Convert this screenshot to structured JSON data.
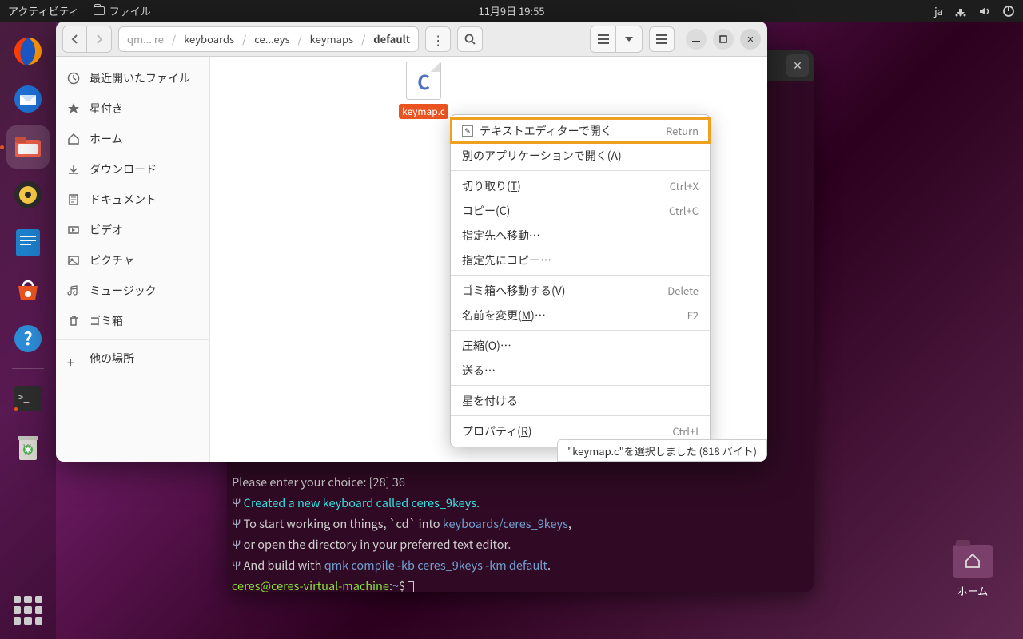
{
  "topbar": {
    "activities": "アクティビティ",
    "app_name": "ファイル",
    "datetime": "11月9日  19:55",
    "lang": "ja"
  },
  "dock": {
    "items": [
      {
        "name": "firefox"
      },
      {
        "name": "thunderbird"
      },
      {
        "name": "files",
        "active": true
      },
      {
        "name": "rhythmbox"
      },
      {
        "name": "libreoffice-writer"
      },
      {
        "name": "software"
      },
      {
        "name": "help"
      }
    ],
    "terminal": {
      "name": "terminal"
    },
    "trash": {
      "name": "trash"
    }
  },
  "desktop": {
    "home_label": "ホーム"
  },
  "terminal": {
    "lines": {
      "choice": "Please enter your choice:  [28] 36",
      "created": "Created a new keyboard called ceres_9keys.",
      "start": "To start working on things, `cd` into ",
      "start_path": "keyboards/ceres_9keys",
      "start_comma": ",",
      "open_dir": "or open the directory in your preferred text editor.",
      "build": "And build with ",
      "build_cmd": "qmk compile -kb ceres_9keys -km default",
      "build_dot": ".",
      "prompt_user": "ceres@ceres-virtual-machine",
      "prompt_sep": ":",
      "prompt_path": "~",
      "prompt_dollar": "$"
    }
  },
  "files": {
    "breadcrumb": [
      "qm... re",
      "keyboards",
      "ce...eys",
      "keymaps",
      "default"
    ],
    "sidebar": [
      {
        "icon": "recent",
        "label": "最近開いたファイル"
      },
      {
        "icon": "star",
        "label": "星付き"
      },
      {
        "icon": "home",
        "label": "ホーム"
      },
      {
        "icon": "download",
        "label": "ダウンロード"
      },
      {
        "icon": "document",
        "label": "ドキュメント"
      },
      {
        "icon": "video",
        "label": "ビデオ"
      },
      {
        "icon": "picture",
        "label": "ピクチャ"
      },
      {
        "icon": "music",
        "label": "ミュージック"
      },
      {
        "icon": "trash",
        "label": "ゴミ箱"
      }
    ],
    "other_places": "他の場所",
    "file": {
      "name": "keymap.c",
      "letter": "C"
    },
    "status": "\"keymap.c\"を選択しました (818 バイト)"
  },
  "context_menu": [
    {
      "label": "テキストエディターで開く",
      "shortcut": "Return",
      "icon": true,
      "highlighted": true
    },
    {
      "label_pre": "別のアプリケーションで開く(",
      "ul": "A",
      "label_post": ")"
    },
    {
      "sep": true
    },
    {
      "label_pre": "切り取り(",
      "ul": "T",
      "label_post": ")",
      "shortcut": "Ctrl+X"
    },
    {
      "label_pre": "コピー(",
      "ul": "C",
      "label_post": ")",
      "shortcut": "Ctrl+C"
    },
    {
      "label": "指定先へ移動…"
    },
    {
      "label": "指定先にコピー…"
    },
    {
      "sep": true
    },
    {
      "label_pre": "ゴミ箱へ移動する(",
      "ul": "V",
      "label_post": ")",
      "shortcut": "Delete"
    },
    {
      "label_pre": "名前を変更(",
      "ul": "M",
      "label_post": ")…",
      "shortcut": "F2"
    },
    {
      "sep": true
    },
    {
      "label_pre": "圧縮(",
      "ul": "O",
      "label_post": ")…"
    },
    {
      "label": "送る…"
    },
    {
      "sep": true
    },
    {
      "label": "星を付ける"
    },
    {
      "sep": true
    },
    {
      "label_pre": "プロパティ(",
      "ul": "R",
      "label_post": ")",
      "shortcut": "Ctrl+I"
    }
  ]
}
